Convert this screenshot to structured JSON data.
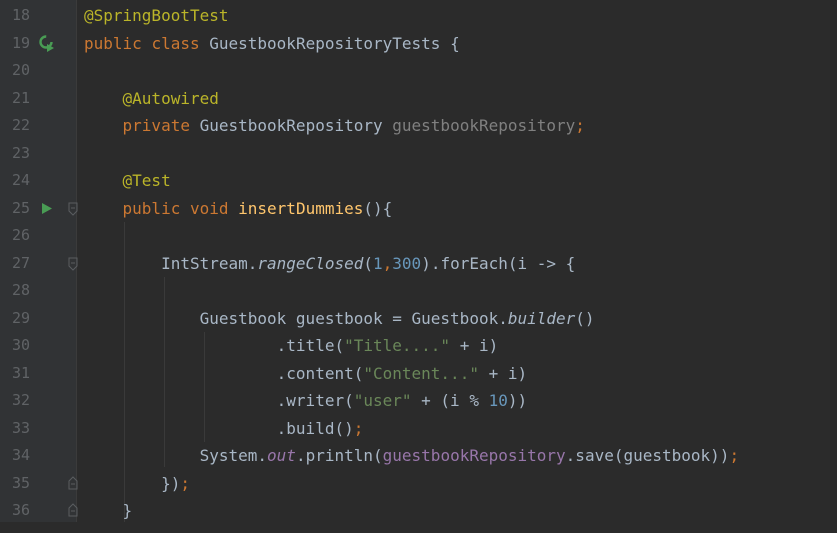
{
  "editor": {
    "colors": {
      "background": "#2b2b2b",
      "keyword": "#cc7832",
      "annotation": "#bbb529",
      "method_decl": "#ffc66d",
      "number": "#6897bb",
      "string": "#6a8759",
      "field": "#9876aa",
      "run_icon": "#499c54"
    },
    "gutter_icons": {
      "19": "run-class-icon",
      "25": "run-test-icon"
    },
    "lines": [
      {
        "num": "18",
        "tokens": [
          {
            "t": "@SpringBootTest",
            "c": "ann"
          }
        ]
      },
      {
        "num": "19",
        "tokens": [
          {
            "t": "public",
            "c": "kw"
          },
          {
            "t": " "
          },
          {
            "t": "class",
            "c": "kw"
          },
          {
            "t": " GuestbookRepositoryTests {"
          }
        ]
      },
      {
        "num": "20",
        "tokens": []
      },
      {
        "num": "21",
        "tokens": [
          {
            "t": "    "
          },
          {
            "t": "@Autowired",
            "c": "ann"
          }
        ]
      },
      {
        "num": "22",
        "tokens": [
          {
            "t": "    "
          },
          {
            "t": "private",
            "c": "kw"
          },
          {
            "t": " GuestbookRepository "
          },
          {
            "t": "guestbookRepository",
            "c": "unused"
          },
          {
            "t": ";",
            "c": "kw"
          }
        ]
      },
      {
        "num": "23",
        "tokens": []
      },
      {
        "num": "24",
        "tokens": [
          {
            "t": "    "
          },
          {
            "t": "@Test",
            "c": "ann"
          }
        ]
      },
      {
        "num": "25",
        "tokens": [
          {
            "t": "    "
          },
          {
            "t": "public",
            "c": "kw"
          },
          {
            "t": " "
          },
          {
            "t": "void",
            "c": "kw"
          },
          {
            "t": " "
          },
          {
            "t": "insertDummies",
            "c": "fn"
          },
          {
            "t": "(){"
          }
        ]
      },
      {
        "num": "26",
        "tokens": []
      },
      {
        "num": "27",
        "tokens": [
          {
            "t": "        IntStream."
          },
          {
            "t": "rangeClosed",
            "c": "it"
          },
          {
            "t": "("
          },
          {
            "t": "1",
            "c": "num"
          },
          {
            "t": ",",
            "c": "kw"
          },
          {
            "t": "300",
            "c": "num"
          },
          {
            "t": ").forEach(i -> {"
          }
        ]
      },
      {
        "num": "28",
        "tokens": []
      },
      {
        "num": "29",
        "tokens": [
          {
            "t": "            Guestbook guestbook = Guestbook."
          },
          {
            "t": "builder",
            "c": "it"
          },
          {
            "t": "()"
          }
        ]
      },
      {
        "num": "30",
        "tokens": [
          {
            "t": "                    .title("
          },
          {
            "t": "\"Title....\"",
            "c": "str"
          },
          {
            "t": " + i)"
          }
        ]
      },
      {
        "num": "31",
        "tokens": [
          {
            "t": "                    .content("
          },
          {
            "t": "\"Content...\"",
            "c": "str"
          },
          {
            "t": " + i)"
          }
        ]
      },
      {
        "num": "32",
        "tokens": [
          {
            "t": "                    .writer("
          },
          {
            "t": "\"user\"",
            "c": "str"
          },
          {
            "t": " + (i % "
          },
          {
            "t": "10",
            "c": "num"
          },
          {
            "t": "))"
          }
        ]
      },
      {
        "num": "33",
        "tokens": [
          {
            "t": "                    .build()"
          },
          {
            "t": ";",
            "c": "kw"
          }
        ]
      },
      {
        "num": "34",
        "tokens": [
          {
            "t": "            System."
          },
          {
            "t": "out",
            "c": "pfld"
          },
          {
            "t": ".println("
          },
          {
            "t": "guestbookRepository",
            "c": "fld"
          },
          {
            "t": ".save(guestbook))"
          },
          {
            "t": ";",
            "c": "kw"
          }
        ]
      },
      {
        "num": "35",
        "tokens": [
          {
            "t": "        })"
          },
          {
            "t": ";",
            "c": "kw"
          }
        ]
      },
      {
        "num": "36",
        "tokens": [
          {
            "t": "    }"
          }
        ]
      }
    ]
  }
}
